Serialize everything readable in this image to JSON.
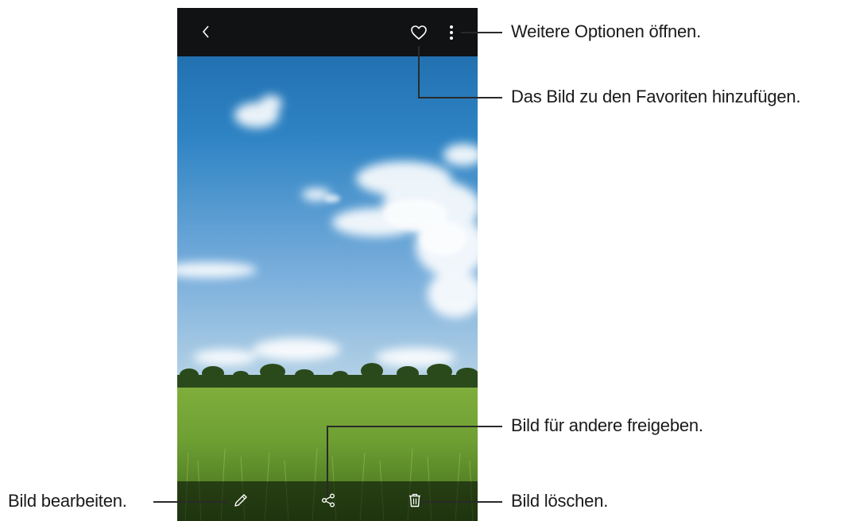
{
  "screen": {
    "top_bar": {
      "back_icon": "chevron-left-icon",
      "favorite_icon": "heart-outline-icon",
      "more_icon": "vertical-dots-icon"
    },
    "bottom_bar": {
      "edit_icon": "pencil-icon",
      "share_icon": "share-icon",
      "delete_icon": "trash-icon"
    },
    "photo": "sky-and-rice-field"
  },
  "callouts": {
    "more_options": "Weitere Optionen öffnen.",
    "add_favorite": "Das Bild zu den Favoriten hinzufügen.",
    "share": "Bild für andere freigeben.",
    "edit": "Bild bearbeiten.",
    "delete": "Bild löschen."
  },
  "colors": {
    "top_bar": "#101214",
    "sky_top": "#1f6fae",
    "sky_bottom": "#9dc4e2",
    "field": "#5e8f2a",
    "leader_line": "#2a2a2a"
  }
}
